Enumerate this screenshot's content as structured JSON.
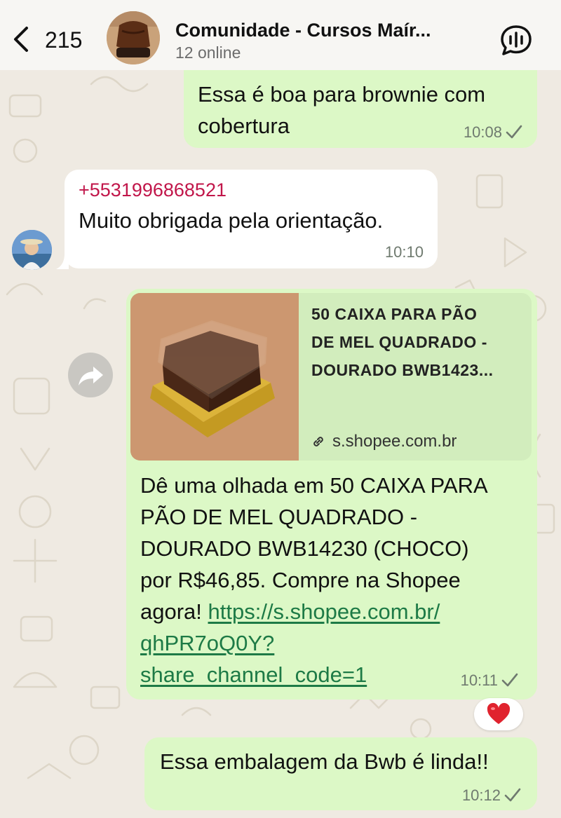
{
  "header": {
    "back_count": "215",
    "title": "Comunidade - Cursos Maír...",
    "subtitle": "12 online"
  },
  "messages": [
    {
      "direction": "outgoing",
      "text_line1": "Essa é boa para brownie com",
      "text_line2": "cobertura",
      "time": "10:08",
      "status": "sent"
    },
    {
      "direction": "incoming",
      "sender": "+5531996868521",
      "text": "Muito obrigada pela orientação.",
      "time": "10:10"
    },
    {
      "direction": "outgoing",
      "preview": {
        "title_line1": "50 CAIXA PARA PÃO",
        "title_line2": "DE MEL QUADRADO -",
        "title_line3": "DOURADO BWB1423...",
        "domain": "s.shopee.com.br"
      },
      "line1": "Dê uma olhada em 50 CAIXA PARA",
      "line2": "PÃO DE MEL QUADRADO -",
      "line3": "DOURADO BWB14230 (CHOCO)",
      "line4": "por R$46,85. Compre na Shopee",
      "line5_text": "agora! ",
      "link_line1": "https://s.shopee.com.br/",
      "link_line2": "qhPR7oQ0Y?",
      "link_line3": "share_channel_code=1",
      "time": "10:11",
      "status": "sent",
      "reaction": "❤️"
    },
    {
      "direction": "outgoing",
      "text": "Essa embalagem da Bwb é linda!!",
      "time": "10:12",
      "status": "sent"
    }
  ],
  "icons": {
    "back": "chevron-left-icon",
    "call": "voice-chat-icon",
    "forward": "forward-icon",
    "link": "link-icon",
    "check": "single-check-icon"
  },
  "colors": {
    "outgoing_bubble": "#dcf8c6",
    "incoming_bubble": "#ffffff",
    "sender_name": "#c1164a",
    "link": "#1d7a46",
    "chat_background": "#efeae2"
  }
}
